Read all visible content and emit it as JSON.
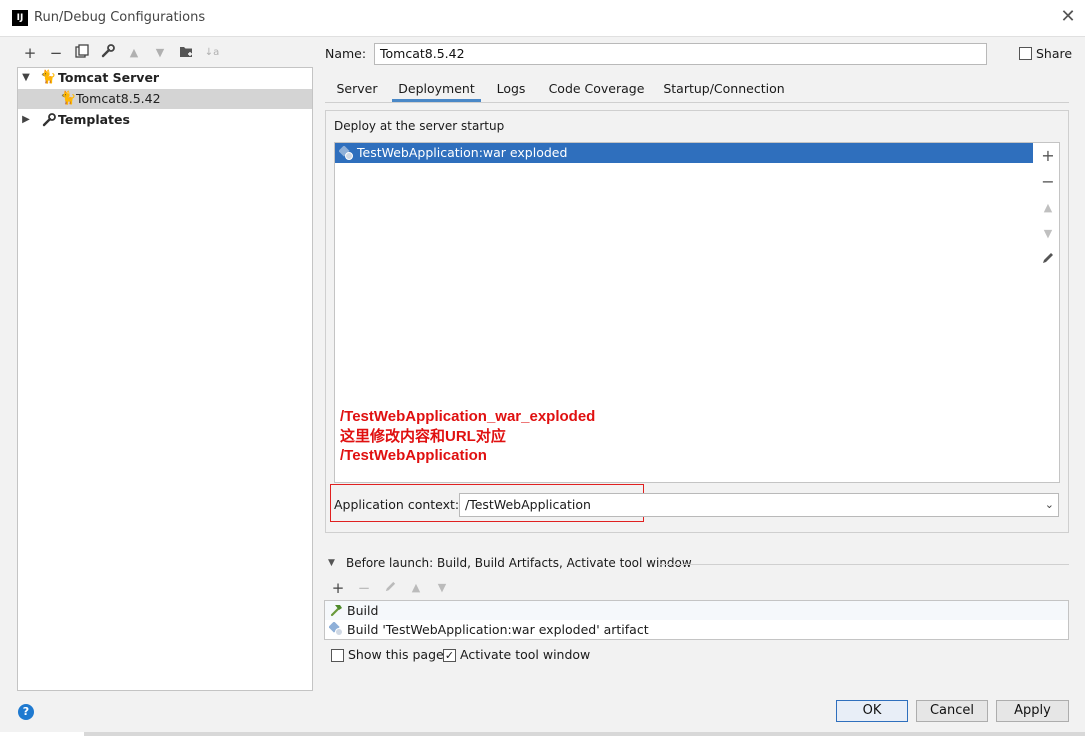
{
  "window": {
    "title": "Run/Debug Configurations",
    "app_icon": "IJ"
  },
  "toolbar": {
    "add": "+",
    "remove": "−",
    "copy": "⧉",
    "edit": "🔧",
    "up": "▲",
    "down": "▼",
    "folder": "▣",
    "sort": "↓a"
  },
  "tree": {
    "items": [
      {
        "label": "Tomcat Server",
        "bold": true
      },
      {
        "label": "Tomcat8.5.42",
        "selected": true
      },
      {
        "label": "Templates",
        "bold": true
      }
    ]
  },
  "name_label": "Name:",
  "name_value": "Tomcat8.5.42",
  "share_label": "Share",
  "tabs": [
    "Server",
    "Deployment",
    "Logs",
    "Code Coverage",
    "Startup/Connection"
  ],
  "deploy": {
    "group_label": "Deploy at the server startup",
    "items": [
      "TestWebApplication:war exploded"
    ]
  },
  "annotation": {
    "line1": "/TestWebApplication_war_exploded",
    "line2": "这里修改内容和URL对应",
    "line3": "/TestWebApplication"
  },
  "app_context": {
    "label": "Application context:",
    "value": "/TestWebApplication"
  },
  "before_launch": {
    "label": "Before launch: Build, Build Artifacts, Activate tool window",
    "items": [
      "Build",
      "Build 'TestWebApplication:war exploded' artifact"
    ]
  },
  "checkboxes": {
    "show_page": "Show this page",
    "activate_tool": "Activate tool window"
  },
  "buttons": {
    "ok": "OK",
    "cancel": "Cancel",
    "apply": "Apply",
    "help": "?"
  },
  "colors": {
    "selection": "#2f6fbd",
    "annotation": "#e01010",
    "tab_underline": "#4a88c7"
  }
}
